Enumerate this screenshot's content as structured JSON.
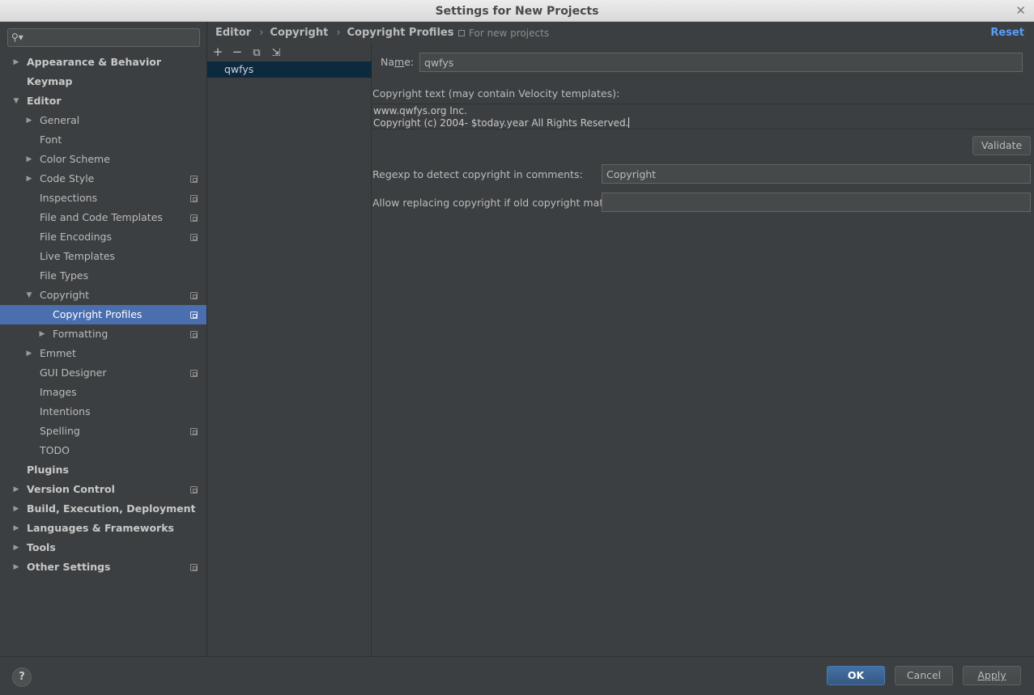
{
  "window": {
    "title": "Settings for New Projects",
    "close_glyph": "✕"
  },
  "search": {
    "placeholder": "",
    "value": ""
  },
  "sidebar": {
    "items": [
      {
        "label": "Appearance & Behavior",
        "level": 0,
        "bold": true,
        "arrow": "right",
        "project": false,
        "selected": false
      },
      {
        "label": "Keymap",
        "level": 0,
        "bold": true,
        "arrow": "",
        "project": false,
        "selected": false
      },
      {
        "label": "Editor",
        "level": 0,
        "bold": true,
        "arrow": "down",
        "project": false,
        "selected": false
      },
      {
        "label": "General",
        "level": 1,
        "bold": false,
        "arrow": "right",
        "project": false,
        "selected": false
      },
      {
        "label": "Font",
        "level": 1,
        "bold": false,
        "arrow": "",
        "project": false,
        "selected": false
      },
      {
        "label": "Color Scheme",
        "level": 1,
        "bold": false,
        "arrow": "right",
        "project": false,
        "selected": false
      },
      {
        "label": "Code Style",
        "level": 1,
        "bold": false,
        "arrow": "right",
        "project": true,
        "selected": false
      },
      {
        "label": "Inspections",
        "level": 1,
        "bold": false,
        "arrow": "",
        "project": true,
        "selected": false
      },
      {
        "label": "File and Code Templates",
        "level": 1,
        "bold": false,
        "arrow": "",
        "project": true,
        "selected": false
      },
      {
        "label": "File Encodings",
        "level": 1,
        "bold": false,
        "arrow": "",
        "project": true,
        "selected": false
      },
      {
        "label": "Live Templates",
        "level": 1,
        "bold": false,
        "arrow": "",
        "project": false,
        "selected": false
      },
      {
        "label": "File Types",
        "level": 1,
        "bold": false,
        "arrow": "",
        "project": false,
        "selected": false
      },
      {
        "label": "Copyright",
        "level": 1,
        "bold": false,
        "arrow": "down",
        "project": true,
        "selected": false
      },
      {
        "label": "Copyright Profiles",
        "level": 2,
        "bold": false,
        "arrow": "",
        "project": true,
        "selected": true
      },
      {
        "label": "Formatting",
        "level": 2,
        "bold": false,
        "arrow": "right",
        "project": true,
        "selected": false
      },
      {
        "label": "Emmet",
        "level": 1,
        "bold": false,
        "arrow": "right",
        "project": false,
        "selected": false
      },
      {
        "label": "GUI Designer",
        "level": 1,
        "bold": false,
        "arrow": "",
        "project": true,
        "selected": false
      },
      {
        "label": "Images",
        "level": 1,
        "bold": false,
        "arrow": "",
        "project": false,
        "selected": false
      },
      {
        "label": "Intentions",
        "level": 1,
        "bold": false,
        "arrow": "",
        "project": false,
        "selected": false
      },
      {
        "label": "Spelling",
        "level": 1,
        "bold": false,
        "arrow": "",
        "project": true,
        "selected": false
      },
      {
        "label": "TODO",
        "level": 1,
        "bold": false,
        "arrow": "",
        "project": false,
        "selected": false
      },
      {
        "label": "Plugins",
        "level": 0,
        "bold": true,
        "arrow": "",
        "project": false,
        "selected": false
      },
      {
        "label": "Version Control",
        "level": 0,
        "bold": true,
        "arrow": "right",
        "project": true,
        "selected": false
      },
      {
        "label": "Build, Execution, Deployment",
        "level": 0,
        "bold": true,
        "arrow": "right",
        "project": false,
        "selected": false
      },
      {
        "label": "Languages & Frameworks",
        "level": 0,
        "bold": true,
        "arrow": "right",
        "project": false,
        "selected": false
      },
      {
        "label": "Tools",
        "level": 0,
        "bold": true,
        "arrow": "right",
        "project": false,
        "selected": false
      },
      {
        "label": "Other Settings",
        "level": 0,
        "bold": true,
        "arrow": "right",
        "project": true,
        "selected": false
      }
    ]
  },
  "breadcrumb": {
    "items": [
      "Editor",
      "Copyright",
      "Copyright Profiles"
    ],
    "separator": "›"
  },
  "scope_note": "For new projects",
  "reset_label": "Reset",
  "profiles": {
    "toolbar": {
      "add": "+",
      "remove": "−",
      "copy": "⧉",
      "import": "⇲"
    },
    "items": [
      "qwfys"
    ]
  },
  "form": {
    "name_label_pre": "Na",
    "name_label_mn": "m",
    "name_label_post": "e:",
    "name_value": "qwfys",
    "copyright_text_label": "Copyright text (may contain Velocity templates):",
    "copyright_text_lines": [
      "www.qwfys.org Inc.",
      "Copyright (c) 2004- $today.year All Rights Reserved."
    ],
    "validate_label": "Validate",
    "regexp_label": "Regexp to detect copyright in comments:",
    "regexp_value": "Copyright",
    "replace_label": "Allow replacing copyright if old copyright matches:",
    "replace_value": ""
  },
  "footer": {
    "help": "?",
    "ok": "OK",
    "cancel": "Cancel",
    "apply": "Apply"
  }
}
